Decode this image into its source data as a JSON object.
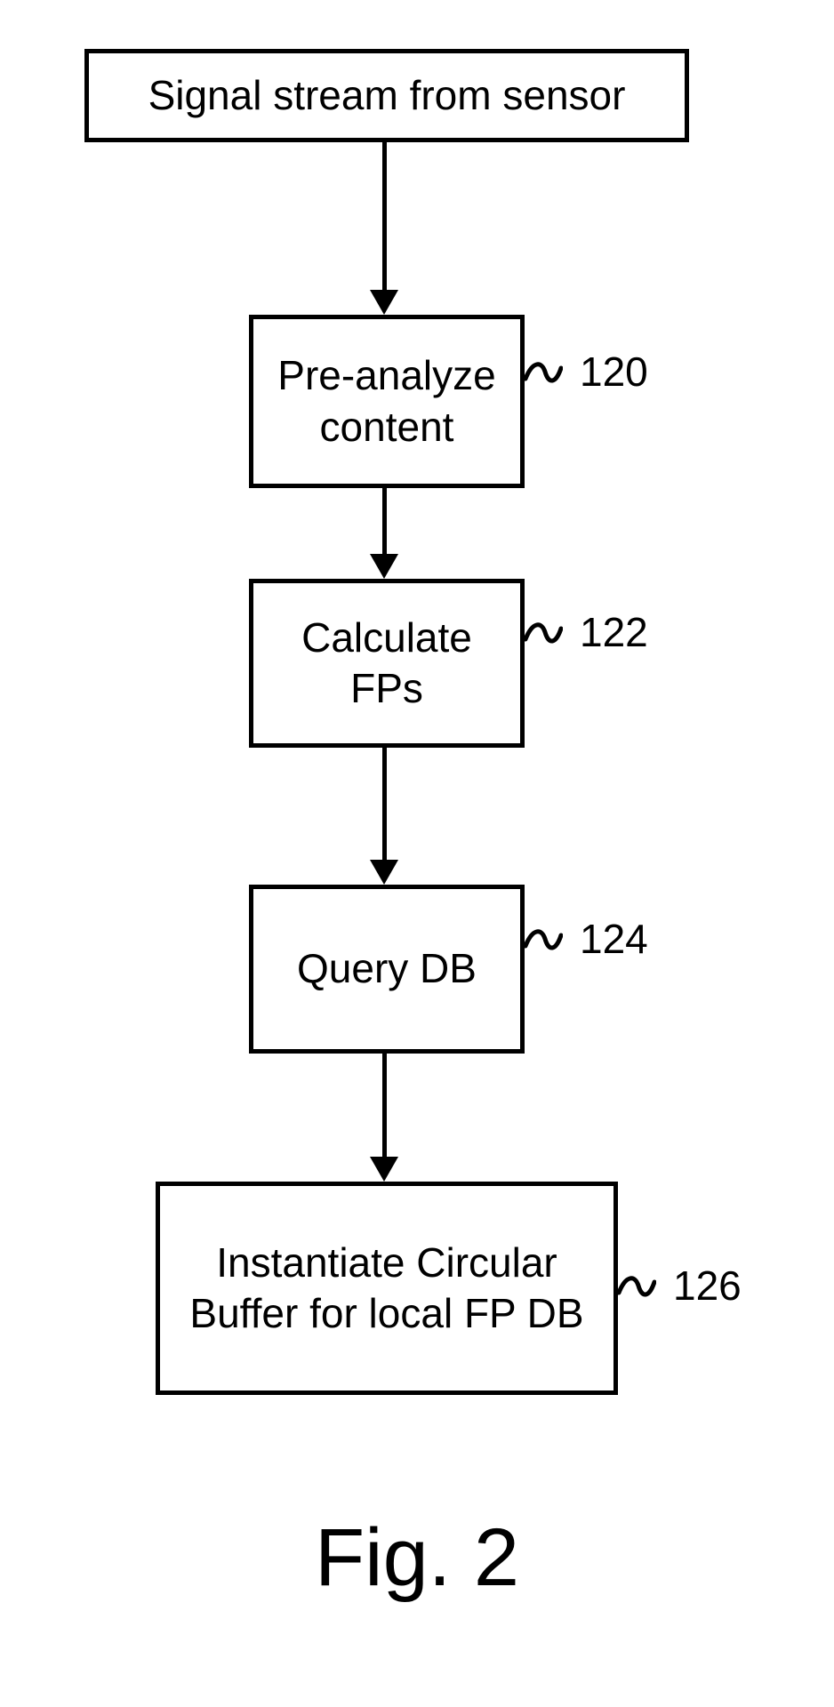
{
  "boxes": {
    "source": {
      "text": "Signal stream from sensor"
    },
    "preanalyze": {
      "text": "Pre-analyze content",
      "ref": "120"
    },
    "calcfps": {
      "text": "Calculate FPs",
      "ref": "122"
    },
    "querydb": {
      "text": "Query DB",
      "ref": "124"
    },
    "circbuf": {
      "text": "Instantiate Circular Buffer for local FP DB",
      "ref": "126"
    }
  },
  "caption": "Fig. 2"
}
